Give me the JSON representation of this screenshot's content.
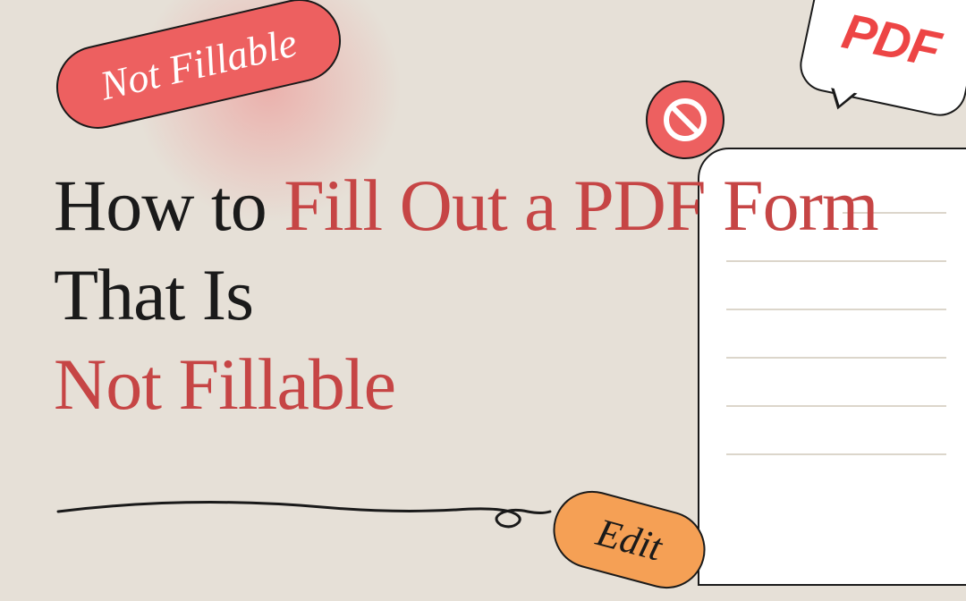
{
  "badges": {
    "not_fillable": "Not Fillable",
    "pdf": "PDF",
    "edit": "Edit"
  },
  "heading": {
    "part1": "How to ",
    "part2": "Fill Out a PDF Form",
    "part3": " That Is ",
    "part4": "Not Fillable"
  }
}
